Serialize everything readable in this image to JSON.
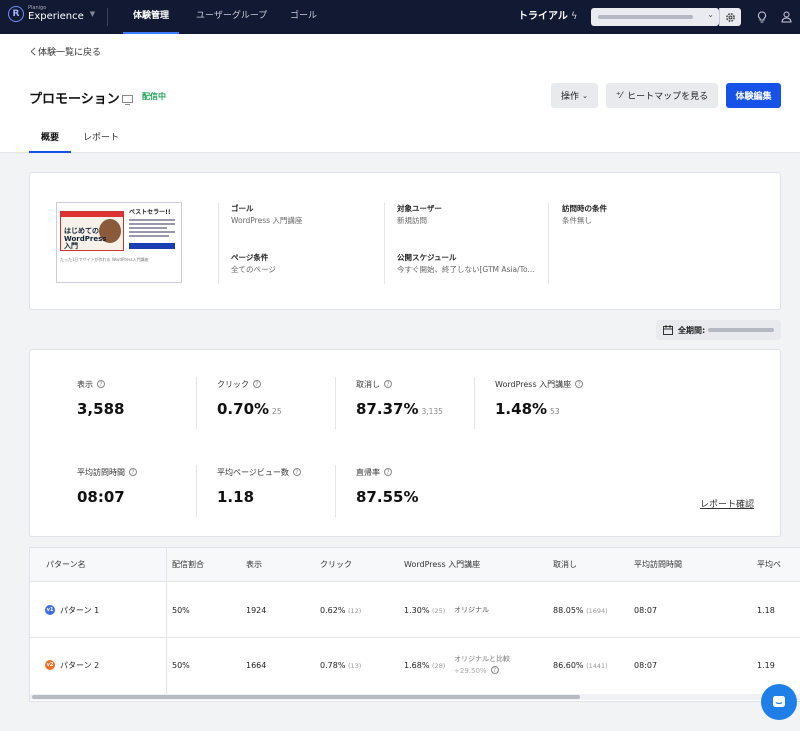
{
  "nav": {
    "logo_sub": "Planigo",
    "logo_main": "Experience",
    "tabs": [
      "体験管理",
      "ユーザーグループ",
      "ゴール"
    ],
    "trial": "トライアル"
  },
  "header": {
    "back": "く体験一覧に戻る",
    "title": "プロモーション",
    "status": "配信中",
    "actions_label": "操作",
    "heatmap_label": "ヒートマップを見る",
    "edit_label": "体験編集",
    "tabs": [
      "概要",
      "レポート"
    ]
  },
  "info": {
    "goal_label": "ゴール",
    "goal_value": "WordPress 入門講座",
    "page_label": "ページ条件",
    "page_value": "全てのページ",
    "target_label": "対象ユーザー",
    "target_value": "新規訪問",
    "schedule_label": "公開スケジュール",
    "schedule_value": "今すぐ開始、終了しない[GTM Asia/To...",
    "visit_label": "訪問時の条件",
    "visit_value": "条件無し",
    "thumb_title": "ベストセラー!!",
    "thumb_big": "はじめての WordPress入門",
    "thumb_sub": "たった1日でサイトが作れる WordPress入門講座"
  },
  "period_label": "全期間:",
  "stats": [
    {
      "label": "表示",
      "value": "3,588",
      "sub": ""
    },
    {
      "label": "クリック",
      "value": "0.70%",
      "sub": "25"
    },
    {
      "label": "取消し",
      "value": "87.37%",
      "sub": "3,135"
    },
    {
      "label": "WordPress 入門講座",
      "value": "1.48%",
      "sub": "53"
    },
    {
      "label": "平均訪問時間",
      "value": "08:07",
      "sub": ""
    },
    {
      "label": "平均ページビュー数",
      "value": "1.18",
      "sub": ""
    },
    {
      "label": "直帰率",
      "value": "87.55%",
      "sub": ""
    }
  ],
  "report_link": "レポート確認",
  "table": {
    "headers": [
      "パターン名",
      "配信割合",
      "表示",
      "クリック",
      "WordPress 入門講座",
      "取消し",
      "平均訪問時間",
      "平均ペ"
    ],
    "rows": [
      {
        "badge": "v1",
        "badge_color": "#3d6fe0",
        "name": "パターン 1",
        "ratio": "50%",
        "views": "1924",
        "click": "0.62%",
        "click_n": "(12)",
        "goal": "1.30%",
        "goal_n": "(25)",
        "note": "オリジナル",
        "note2": "",
        "cancel": "88.05%",
        "cancel_n": "(1694)",
        "time": "08:07",
        "pv": "1.18"
      },
      {
        "badge": "v2",
        "badge_color": "#e8722c",
        "name": "パターン 2",
        "ratio": "50%",
        "views": "1664",
        "click": "0.78%",
        "click_n": "(13)",
        "goal": "1.68%",
        "goal_n": "(28)",
        "note": "オリジナルと比較",
        "note2": "+29.50%",
        "cancel": "86.60%",
        "cancel_n": "(1441)",
        "time": "08:07",
        "pv": "1.19"
      }
    ]
  },
  "colors": {
    "nav_bg": "#121a33",
    "primary": "#1652e8",
    "live": "#1fa35a"
  }
}
